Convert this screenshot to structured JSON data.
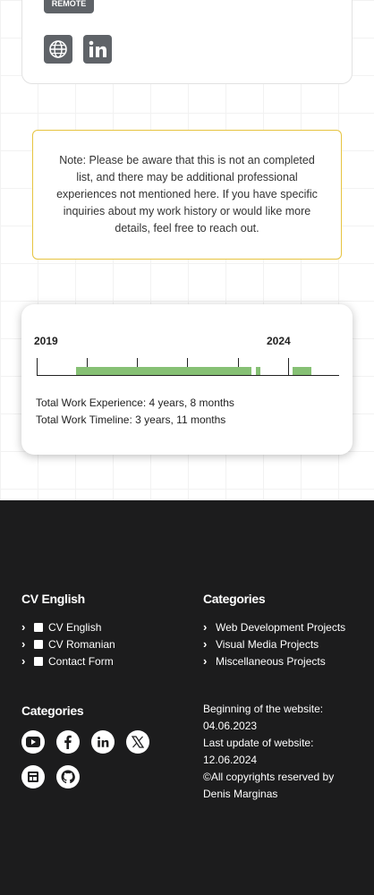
{
  "top_card": {
    "badge": "REMOTE",
    "icons": [
      "globe-icon",
      "linkedin-icon"
    ]
  },
  "note": {
    "text": "Note: Please be aware that this is not an completed list, and there may be additional professional experiences not mentioned here. If you have specific inquiries about my work history or would like more details, feel free to reach out."
  },
  "timeline": {
    "start_year": "2019",
    "end_year": "2024",
    "total_experience": "Total Work Experience: 4 years, 8 months",
    "total_timeline": "Total Work Timeline: 3 years, 11 months",
    "accent_color": "#86c074"
  },
  "footer": {
    "col1_heading": "CV English",
    "col1_links": [
      {
        "label": "CV English",
        "icon": "badge-icon"
      },
      {
        "label": "CV Romanian",
        "icon": "badge-icon"
      },
      {
        "label": "Contact Form",
        "icon": "list-icon"
      }
    ],
    "col2_heading": "Categories",
    "col2_links": [
      {
        "label": "Web Development Projects"
      },
      {
        "label": "Visual Media Projects"
      },
      {
        "label": "Miscellaneous Projects"
      }
    ],
    "social_heading": "Categories",
    "social_icons": [
      "youtube-icon",
      "facebook-icon",
      "linkedin-icon",
      "x-icon",
      "website-icon",
      "github-icon"
    ],
    "info": {
      "begin_label": "Beginning of the website:",
      "begin_date": "04.06.2023",
      "update_label": "Last update of website:",
      "update_date": "12.06.2024",
      "copyright": "©All copyrights reserved by",
      "author": "Denis Marginas"
    }
  }
}
